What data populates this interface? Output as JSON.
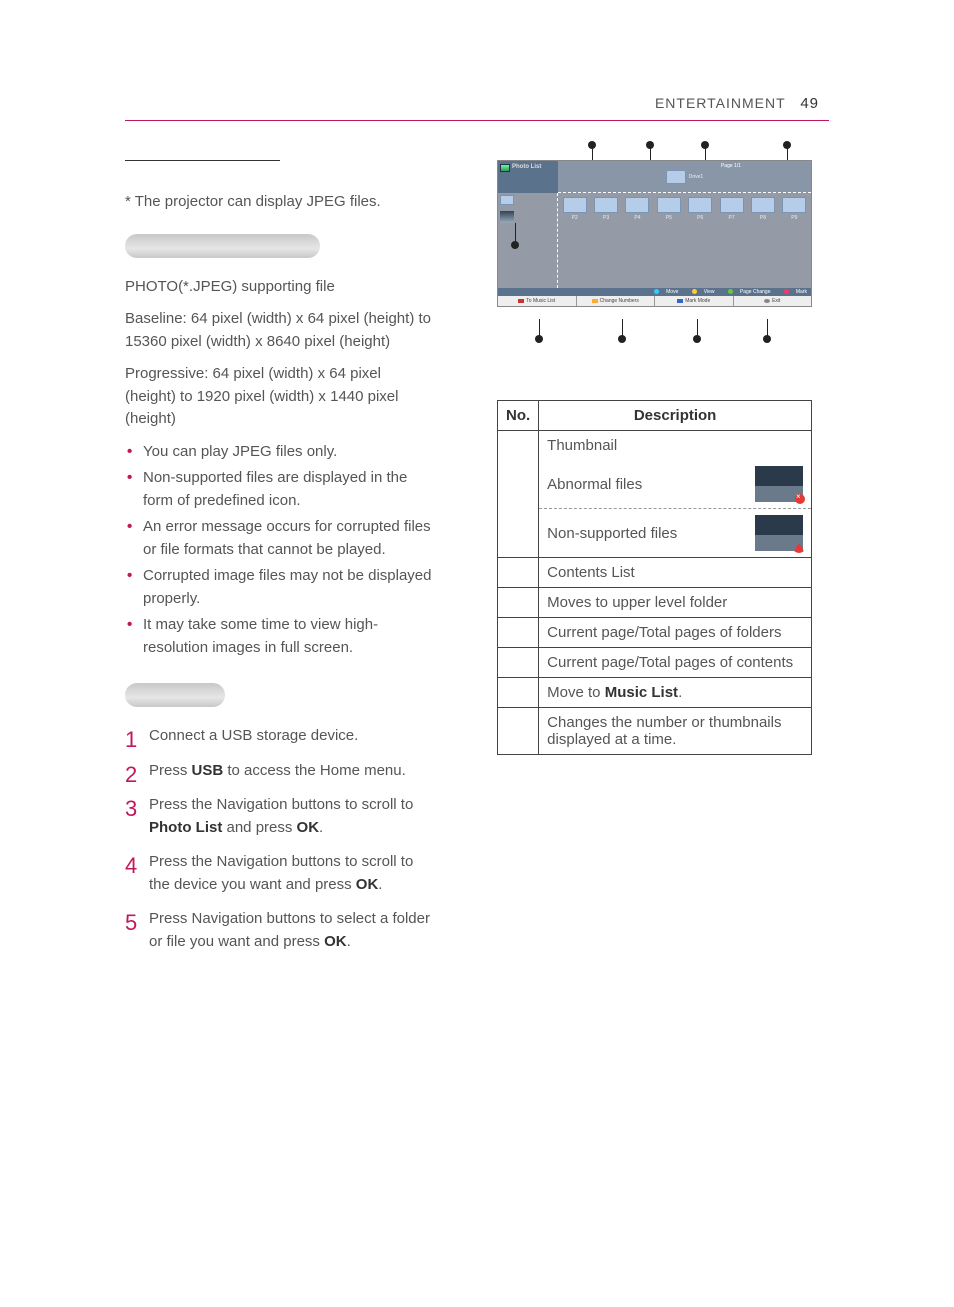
{
  "header": {
    "section": "ENTERTAINMENT",
    "page": "49"
  },
  "footnote": "*  The projector can display JPEG files.",
  "spec": {
    "line1": "PHOTO(*.JPEG) supporting file",
    "line2": "Baseline: 64 pixel (width) x 64 pixel (height) to 15360 pixel (width) x 8640 pixel (height)",
    "line3": "Progressive: 64 pixel (width) x 64 pixel (height) to 1920 pixel (width) x 1440 pixel (height)"
  },
  "bullets": [
    "You can play JPEG files only.",
    "Non-supported files are displayed in the form of predefined icon.",
    "An error message occurs for corrupted files or file formats that cannot be played.",
    "Corrupted image files may not be displayed properly.",
    "It may take some time to view high-resolution images in full screen."
  ],
  "steps": {
    "s1": "Connect a USB storage device.",
    "s2a": "Press ",
    "s2b": "USB",
    "s2c": " to access the Home menu.",
    "s3a": "Press the Navigation buttons to scroll to ",
    "s3b": "Photo List",
    "s3c": " and press ",
    "s3d": "OK",
    "s3e": ".",
    "s4a": "Press the Navigation buttons to scroll to the device you want and press ",
    "s4b": "OK",
    "s4c": ".",
    "s5a": "Press Navigation buttons to select a folder or file you want and press ",
    "s5b": "OK",
    "s5c": "."
  },
  "mockup": {
    "title": "Photo List",
    "path_label": "Drive1",
    "page_top": "Page 1/1",
    "folders": [
      "P2",
      "P3",
      "P4",
      "P5",
      "P6",
      "P7",
      "P8",
      "P9"
    ],
    "hints": {
      "move": "Move",
      "view": "View",
      "page": "Page Change",
      "mark": "Mark"
    },
    "bottom": {
      "b1": "To Music List",
      "b2": "Change Numbers",
      "b3": "Mark Mode",
      "b4": "Exit"
    }
  },
  "table": {
    "h1": "No.",
    "h2": "Description",
    "r1": "Thumbnail",
    "r1a": "Abnormal files",
    "r1b": "Non-supported files",
    "r2": "Contents List",
    "r3": "Moves to upper level folder",
    "r4": "Current page/Total pages of folders",
    "r5": "Current page/Total pages of contents",
    "r6a": "Move to ",
    "r6b": "Music List",
    "r6c": ".",
    "r7": "Changes the number or thumbnails displayed at a time."
  }
}
